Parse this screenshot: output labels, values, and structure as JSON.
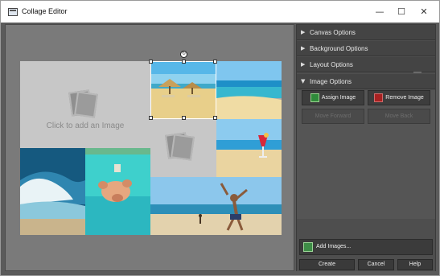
{
  "window": {
    "title": "Collage Editor"
  },
  "titlebar_controls": {
    "minimize": "—",
    "maximize": "☐",
    "close": "✕"
  },
  "canvas": {
    "placeholder_text": "Click to add an Image",
    "rotate_glyph": "↻"
  },
  "panel": {
    "sections": [
      {
        "label": "Canvas Options",
        "expanded": false
      },
      {
        "label": "Background Options",
        "expanded": false
      },
      {
        "label": "Layout Options",
        "expanded": false
      },
      {
        "label": "Image Options",
        "expanded": true
      }
    ],
    "arrows": {
      "collapsed": "▶",
      "expanded": "▼"
    },
    "image_options": {
      "assign_label": "Assign Image",
      "remove_label": "Remove Image",
      "move_forward_label": "Move Forward",
      "move_back_label": "Move Back"
    },
    "add_images_label": "Add Images...",
    "footer": {
      "create_label": "Create",
      "cancel_label": "Cancel",
      "help_label": "Help"
    }
  },
  "colors": {
    "workspace": "#7a7a7a",
    "canvas": "#adadad",
    "empty_cell": "#c7c7c7",
    "panel": "#4e4e4e",
    "section_header": "#444444"
  }
}
